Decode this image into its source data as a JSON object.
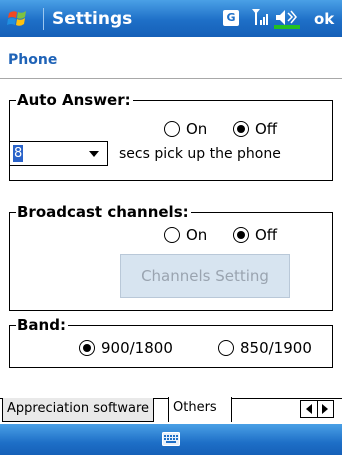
{
  "window": {
    "title": "Settings",
    "ok_label": "ok",
    "indicator_g": "G"
  },
  "page": {
    "title": "Phone"
  },
  "auto_answer": {
    "legend": "Auto Answer:",
    "on_label": "On",
    "off_label": "Off",
    "selected": "Off",
    "seconds_value": "8",
    "seconds_text": "secs pick up the phone"
  },
  "broadcast": {
    "legend": "Broadcast channels:",
    "on_label": "On",
    "off_label": "Off",
    "selected": "Off",
    "channels_button": "Channels Setting"
  },
  "band": {
    "legend": "Band:",
    "option1": "900/1800",
    "option2": "850/1900",
    "selected": "900/1800"
  },
  "tabs": [
    {
      "label": "Appreciation software",
      "active": false
    },
    {
      "label": "Others",
      "active": true
    }
  ],
  "colors": {
    "titlebar": "#1e6fc7",
    "page_title": "#1f63b7",
    "selection": "#2a63c9"
  },
  "icons": {
    "start": "windows-flag-icon",
    "signal": "signal-icon",
    "volume": "volume-icon",
    "keyboard": "keyboard-icon"
  }
}
